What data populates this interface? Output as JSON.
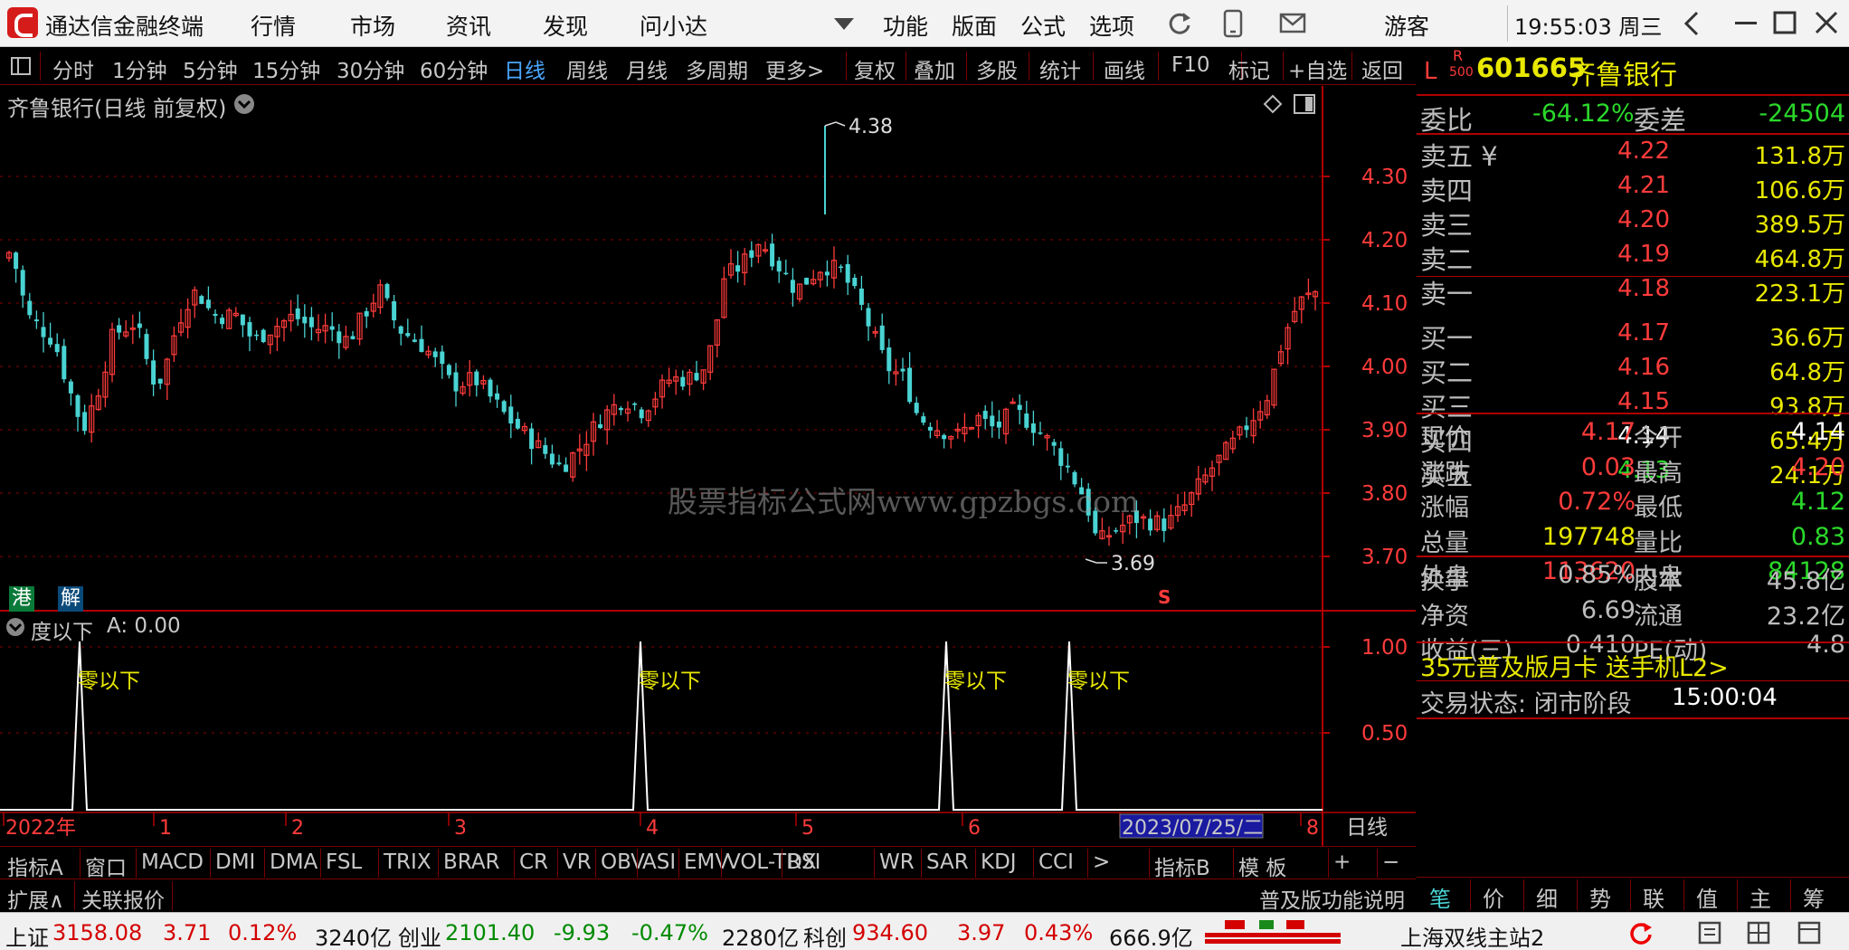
{
  "titlebar": {
    "app_name": "通达信金融终端",
    "menu": [
      "行情",
      "市场",
      "资讯",
      "发现",
      "问小达"
    ],
    "right_menu": [
      "功能",
      "版面",
      "公式",
      "选项"
    ],
    "user": "游客",
    "clock": "19:55:03 周三"
  },
  "periods": [
    "分时",
    "1分钟",
    "5分钟",
    "15分钟",
    "30分钟",
    "60分钟",
    "日线",
    "周线",
    "月线",
    "多周期",
    "更多>"
  ],
  "tools": [
    "复权",
    "叠加",
    "多股",
    "统计",
    "画线",
    "F10",
    "标记",
    "+自选",
    "返回"
  ],
  "chart": {
    "title": "齐鲁银行(日线 前复权)",
    "high_label": "4.38",
    "low_label": "3.69",
    "watermark": "股票指标公式网www.gpzbgs.com",
    "badge_gang": "港",
    "badge_jie": "解",
    "s_mark": "S",
    "price_axis": [
      "4.30",
      "4.20",
      "4.10",
      "4.00",
      "3.90",
      "3.80",
      "3.70"
    ]
  },
  "indicator": {
    "title": "度以下",
    "value_label": "A: 0.00",
    "signal_text": "零以下",
    "axis": [
      "1.00",
      "0.50"
    ]
  },
  "time_axis": {
    "labels": [
      "2022年",
      "1",
      "2",
      "3",
      "4",
      "5",
      "6",
      "2023/07/25/二",
      "8"
    ],
    "right": "日线"
  },
  "tabs": [
    "指标A",
    "窗口",
    "MACD",
    "DMI",
    "DMA",
    "FSL",
    "TRIX",
    "BRAR",
    "CR",
    "VR",
    "OBV",
    "ASI",
    "EMV",
    "VOL-TDX",
    "RSI",
    "WR",
    "SAR",
    "KDJ",
    "CCI",
    ">",
    "指标B",
    "模 板",
    "+",
    "−"
  ],
  "ext_bar": {
    "left": [
      "扩展∧",
      "关联报价"
    ],
    "promo": "普及版功能说明"
  },
  "quote": {
    "market_L": "L",
    "r_label": "R",
    "r_sub": "500",
    "code": "601665",
    "name": "齐鲁银行",
    "webi_label": "委比",
    "webi": "-64.12%",
    "weicha_label": "委差",
    "weicha": "-24504",
    "sells": [
      {
        "label": "卖五 ¥",
        "price": "4.22",
        "vol": "131.8万"
      },
      {
        "label": "卖四",
        "price": "4.21",
        "vol": "106.6万"
      },
      {
        "label": "卖三",
        "price": "4.20",
        "vol": "389.5万"
      },
      {
        "label": "卖二",
        "price": "4.19",
        "vol": "464.8万"
      },
      {
        "label": "卖一",
        "price": "4.18",
        "vol": "223.1万"
      }
    ],
    "buys": [
      {
        "label": "买一",
        "price": "4.17",
        "vol": "36.6万"
      },
      {
        "label": "买二",
        "price": "4.16",
        "vol": "64.8万"
      },
      {
        "label": "买三",
        "price": "4.15",
        "vol": "93.8万"
      },
      {
        "label": "买四",
        "price": "4.14",
        "vol": "65.4万"
      },
      {
        "label": "买五",
        "price": "4.13",
        "vol": "24.1万"
      }
    ],
    "stats": [
      {
        "l": "现价",
        "v": "4.17",
        "l2": "今开",
        "v2": "4.14"
      },
      {
        "l": "涨跌",
        "v": "0.03",
        "l2": "最高",
        "v2": "4.20"
      },
      {
        "l": "涨幅",
        "v": "0.72%",
        "l2": "最低",
        "v2": "4.12"
      },
      {
        "l": "总量",
        "v": "197748",
        "l2": "量比",
        "v2": "0.83"
      },
      {
        "l": "外盘",
        "v": "113620",
        "l2": "内盘",
        "v2": "84128"
      }
    ],
    "stats2": [
      {
        "l": "换手",
        "v": "0.85%",
        "l2": "股本",
        "v2": "45.8亿"
      },
      {
        "l": "净资",
        "v": "6.69",
        "l2": "流通",
        "v2": "23.2亿"
      },
      {
        "l": "收益(三)",
        "v": "0.410",
        "l2": "PE(动)",
        "v2": "4.8"
      }
    ],
    "promo": "35元普及版月卡 送手机L2>",
    "trade_status": "交易状态: 闭市阶段",
    "trade_time": "15:00:04",
    "tabs": [
      "笔",
      "价",
      "细",
      "势",
      "联",
      "值",
      "主",
      "筹"
    ]
  },
  "statusbar": {
    "sh_label": "上证",
    "sh_val": "3158.08",
    "sh_chg": "3.71",
    "sh_pct": "0.12%",
    "sh_amt": "3240亿",
    "cy_label": "创业",
    "cy_val": "2101.40",
    "cy_chg": "-9.93",
    "cy_pct": "-0.47%",
    "cy_amt": "2280亿",
    "kc_label": "科创",
    "kc_val": "934.60",
    "kc_chg": "3.97",
    "kc_pct": "0.43%",
    "kc_amt": "666.9亿",
    "server": "上海双线主站2"
  },
  "colors": {
    "up": "#ff3b3b",
    "down": "#4ad3d3",
    "grid": "#8b0000",
    "signal": "#ffffff",
    "label": "#e8e800"
  }
}
